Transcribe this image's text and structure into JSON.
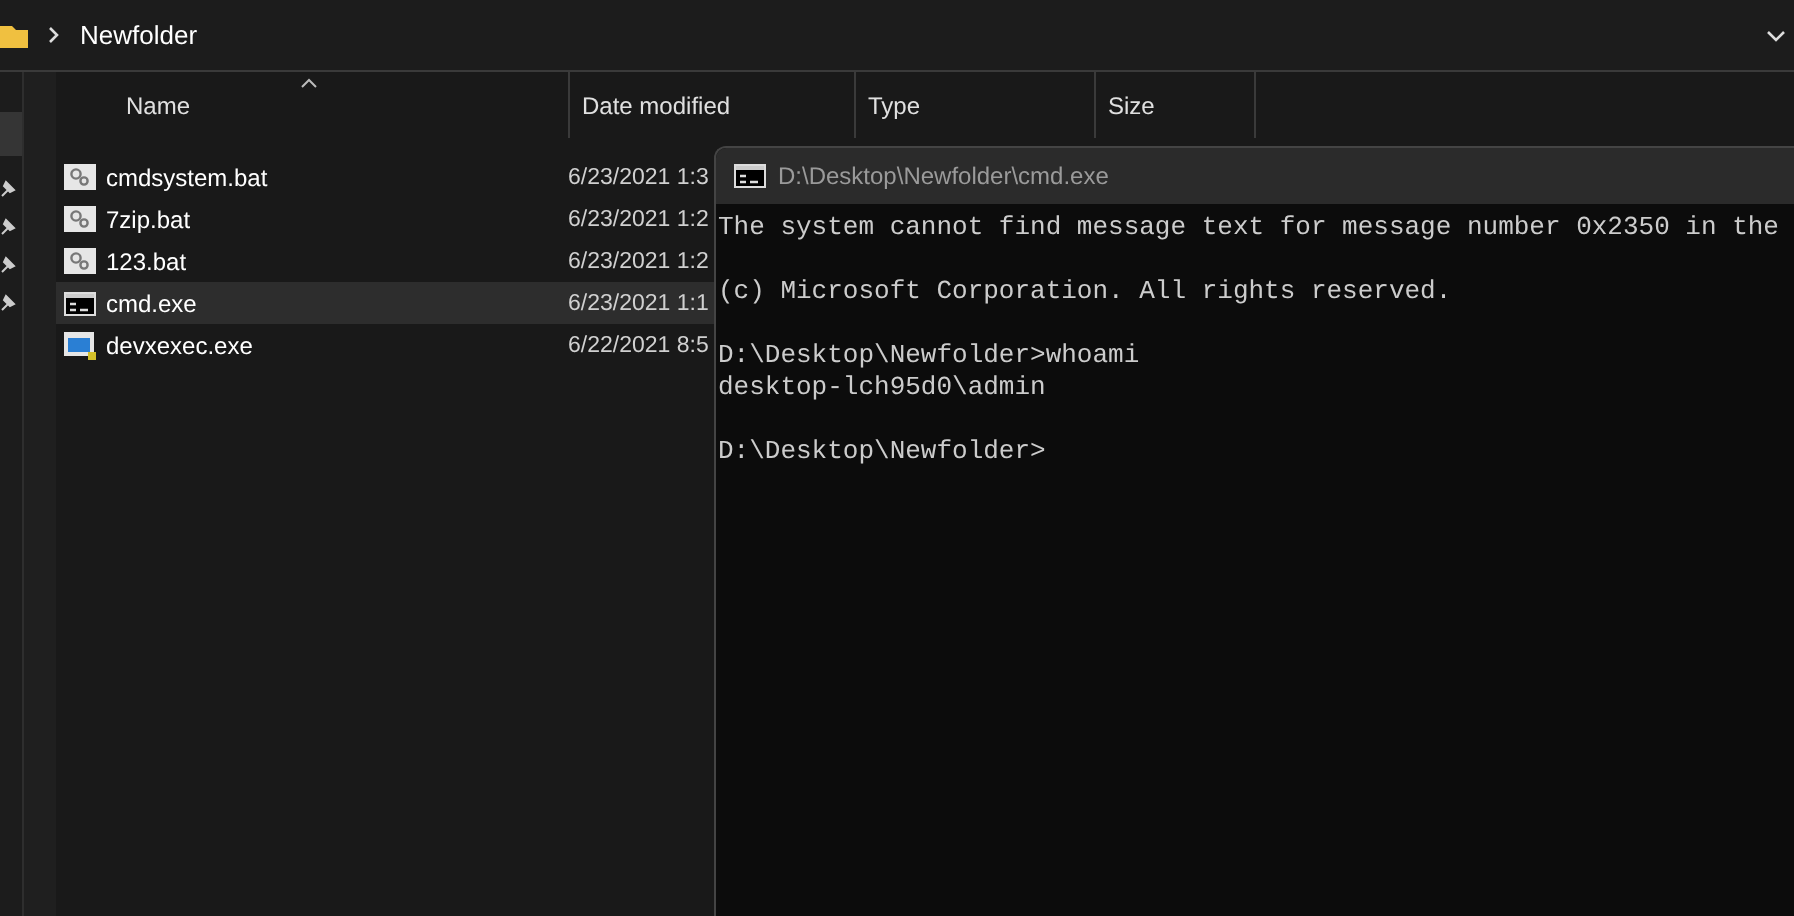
{
  "explorer": {
    "breadcrumb": "Newfolder",
    "columns": [
      "Name",
      "Date modified",
      "Type",
      "Size"
    ],
    "files": [
      {
        "name": "cmdsystem.bat",
        "kind": "batch",
        "date": "6/23/2021 1:3",
        "selected": false
      },
      {
        "name": "7zip.bat",
        "kind": "batch",
        "date": "6/23/2021 1:2",
        "selected": false
      },
      {
        "name": "123.bat",
        "kind": "batch",
        "date": "6/23/2021 1:2",
        "selected": false
      },
      {
        "name": "cmd.exe",
        "kind": "console",
        "date": "6/23/2021 1:1",
        "selected": true
      },
      {
        "name": "devxexec.exe",
        "kind": "app",
        "date": "6/22/2021 8:5",
        "selected": false
      }
    ]
  },
  "console": {
    "title": "D:\\Desktop\\Newfolder\\cmd.exe",
    "blocks": [
      [
        "The system cannot find message text for message number 0x2350 in the"
      ],
      [
        "(c) Microsoft Corporation. All rights reserved."
      ],
      [
        "D:\\Desktop\\Newfolder>whoami",
        "desktop-lch95d0\\admin"
      ],
      [
        "D:\\Desktop\\Newfolder>"
      ]
    ]
  }
}
